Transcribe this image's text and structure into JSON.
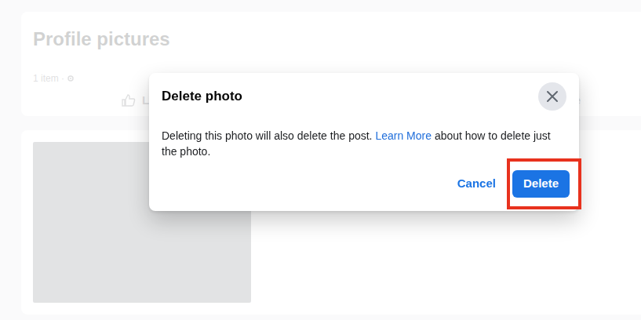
{
  "page": {
    "album_title": "Profile pictures",
    "item_count": "1 item ·",
    "actions": [
      {
        "label": "L"
      },
      {
        "label": "Share"
      }
    ]
  },
  "dialog": {
    "title": "Delete photo",
    "message": {
      "before": "Deleting this photo will also delete the post.",
      "link": "Learn More",
      "after": "about how to delete just the photo."
    },
    "buttons": [
      {
        "label": "Cancel",
        "kind": "link",
        "highlighted": false
      },
      {
        "label": "Delete",
        "kind": "primary",
        "highlighted": true
      }
    ]
  }
}
